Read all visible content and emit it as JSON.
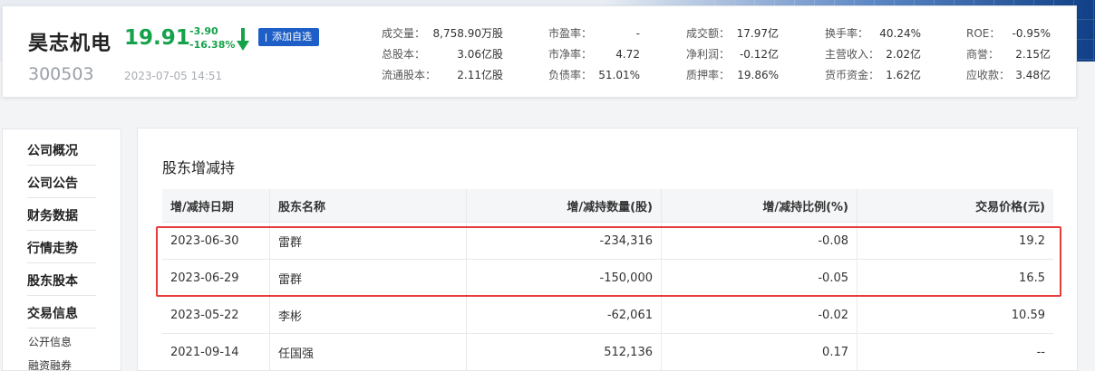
{
  "stock": {
    "name": "昊志机电",
    "price": "19.91",
    "change_amount": "-3.90",
    "change_percent": "-16.38%",
    "code": "300503",
    "datetime": "2023-07-05 14:51",
    "add_watch_label": "添加自选",
    "price_color": "#15a24a"
  },
  "metrics": {
    "col1": [
      {
        "k": "成交量：",
        "v": "8,758.90万股"
      },
      {
        "k": "总股本：",
        "v": "3.06亿股"
      },
      {
        "k": "流通股本：",
        "v": "2.11亿股"
      }
    ],
    "col2": [
      {
        "k": "市盈率：",
        "v": "-"
      },
      {
        "k": "市净率：",
        "v": "4.72"
      },
      {
        "k": "负债率：",
        "v": "51.01%"
      }
    ],
    "col3": [
      {
        "k": "成交额：",
        "v": "17.97亿"
      },
      {
        "k": "净利润：",
        "v": "-0.12亿"
      },
      {
        "k": "质押率：",
        "v": "19.86%"
      }
    ],
    "col4": [
      {
        "k": "换手率：",
        "v": "40.24%"
      },
      {
        "k": "主营收入：",
        "v": "2.02亿"
      },
      {
        "k": "货币资金：",
        "v": "1.62亿"
      }
    ],
    "col5": [
      {
        "k": "ROE：",
        "v": "-0.95%"
      },
      {
        "k": "商誉：",
        "v": "2.15亿"
      },
      {
        "k": "应收款：",
        "v": "3.48亿"
      }
    ]
  },
  "sidebar": {
    "items": [
      "公司概况",
      "公司公告",
      "财务数据",
      "行情走势",
      "股东股本",
      "交易信息"
    ],
    "sub_items": [
      "公开信息",
      "融资融券"
    ]
  },
  "section": {
    "title": "股东增减持"
  },
  "table": {
    "headers": [
      "增/减持日期",
      "股东名称",
      "增/减持数量(股)",
      "增/减持比例(%)",
      "交易价格(元)"
    ],
    "rows": [
      [
        "2023-06-30",
        "雷群",
        "-234,316",
        "-0.08",
        "19.2"
      ],
      [
        "2023-06-29",
        "雷群",
        "-150,000",
        "-0.05",
        "16.5"
      ],
      [
        "2023-05-22",
        "李彬",
        "-62,061",
        "-0.02",
        "10.59"
      ],
      [
        "2021-09-14",
        "任国强",
        "512,136",
        "0.17",
        "--"
      ]
    ]
  },
  "colors": {
    "brand_blue": "#1d5fc7",
    "down_green": "#15a24a",
    "highlight_red": "#e63c3c"
  }
}
